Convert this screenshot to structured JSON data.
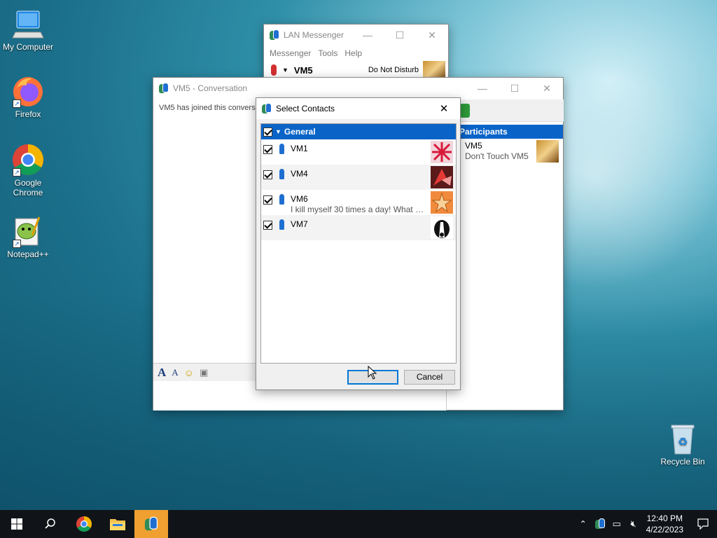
{
  "desktop": {
    "icons": [
      {
        "label": "My Computer"
      },
      {
        "label": "Firefox"
      },
      {
        "label": "Google Chrome"
      },
      {
        "label": "Notepad++"
      },
      {
        "label": "Recycle Bin"
      }
    ]
  },
  "lan_messenger": {
    "title": "LAN Messenger",
    "menu": [
      "Messenger",
      "Tools",
      "Help"
    ],
    "user_name": "VM5",
    "status": "Do Not Disturb"
  },
  "conversation": {
    "title": "VM5 - Conversation",
    "message": "VM5 has joined this conversa",
    "participants_header": "Participants",
    "participant": {
      "name": "VM5",
      "status": "Don't Touch VM5"
    }
  },
  "select_contacts": {
    "title": "Select Contacts",
    "group": "General",
    "contacts": [
      {
        "name": "VM1",
        "note": ""
      },
      {
        "name": "VM4",
        "note": ""
      },
      {
        "name": "VM6",
        "note": "I kill myself 30 times a day! What a..."
      },
      {
        "name": "VM7",
        "note": ""
      }
    ],
    "ok_label": "",
    "cancel_label": "Cancel"
  },
  "taskbar": {
    "time": "12:40 PM",
    "date": "4/22/2023"
  },
  "colors": {
    "selection_blue": "#0a64c8",
    "taskbar": "#101418",
    "active_app": "#f0a030"
  }
}
